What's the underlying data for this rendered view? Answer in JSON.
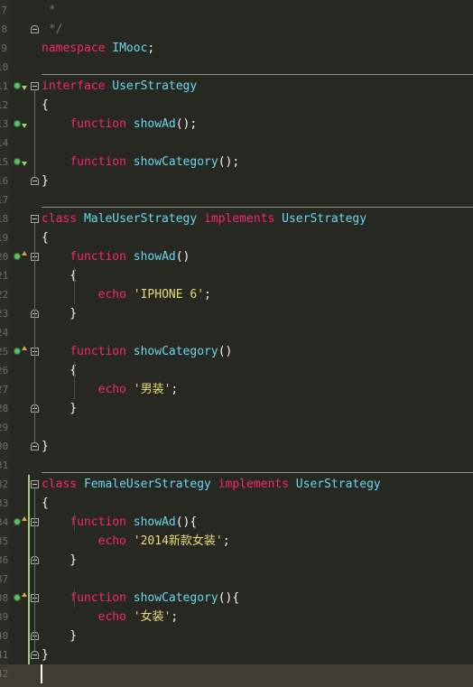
{
  "editor": {
    "lines": [
      {
        "num": "7",
        "tokens": [
          {
            "t": "cm",
            "v": " *"
          }
        ]
      },
      {
        "num": "8",
        "tokens": [
          {
            "t": "cm",
            "v": " */"
          }
        ]
      },
      {
        "num": "9",
        "tokens": [
          {
            "t": "kw",
            "v": "namespace"
          },
          {
            "t": "p",
            "v": " "
          },
          {
            "t": "cls",
            "v": "IMooc"
          },
          {
            "t": "p",
            "v": ";"
          }
        ]
      },
      {
        "num": "10",
        "tokens": []
      },
      {
        "num": "11",
        "tokens": [
          {
            "t": "kw",
            "v": "interface"
          },
          {
            "t": "p",
            "v": " "
          },
          {
            "t": "cls",
            "v": "UserStrategy"
          }
        ]
      },
      {
        "num": "12",
        "tokens": [
          {
            "t": "p",
            "v": "{"
          }
        ]
      },
      {
        "num": "13",
        "tokens": [
          {
            "t": "p",
            "v": "    "
          },
          {
            "t": "kw",
            "v": "function"
          },
          {
            "t": "p",
            "v": " "
          },
          {
            "t": "fn",
            "v": "showAd"
          },
          {
            "t": "p",
            "v": "();"
          }
        ]
      },
      {
        "num": "14",
        "tokens": []
      },
      {
        "num": "15",
        "tokens": [
          {
            "t": "p",
            "v": "    "
          },
          {
            "t": "kw",
            "v": "function"
          },
          {
            "t": "p",
            "v": " "
          },
          {
            "t": "fn",
            "v": "showCategory"
          },
          {
            "t": "p",
            "v": "();"
          }
        ]
      },
      {
        "num": "16",
        "tokens": [
          {
            "t": "p",
            "v": "}"
          }
        ]
      },
      {
        "num": "17",
        "tokens": []
      },
      {
        "num": "18",
        "tokens": [
          {
            "t": "kw",
            "v": "class"
          },
          {
            "t": "p",
            "v": " "
          },
          {
            "t": "cls",
            "v": "MaleUserStrategy"
          },
          {
            "t": "p",
            "v": " "
          },
          {
            "t": "kw",
            "v": "implements"
          },
          {
            "t": "p",
            "v": " "
          },
          {
            "t": "cls",
            "v": "UserStrategy"
          }
        ]
      },
      {
        "num": "19",
        "tokens": [
          {
            "t": "p",
            "v": "{"
          }
        ]
      },
      {
        "num": "20",
        "tokens": [
          {
            "t": "p",
            "v": "    "
          },
          {
            "t": "kw",
            "v": "function"
          },
          {
            "t": "p",
            "v": " "
          },
          {
            "t": "fn",
            "v": "showAd"
          },
          {
            "t": "p",
            "v": "()"
          }
        ]
      },
      {
        "num": "21",
        "tokens": [
          {
            "t": "p",
            "v": "    {"
          }
        ]
      },
      {
        "num": "22",
        "tokens": [
          {
            "t": "p",
            "v": "        "
          },
          {
            "t": "kw",
            "v": "echo"
          },
          {
            "t": "p",
            "v": " "
          },
          {
            "t": "str",
            "v": "'IPHONE 6'"
          },
          {
            "t": "p",
            "v": ";"
          }
        ]
      },
      {
        "num": "23",
        "tokens": [
          {
            "t": "p",
            "v": "    }"
          }
        ]
      },
      {
        "num": "24",
        "tokens": []
      },
      {
        "num": "25",
        "tokens": [
          {
            "t": "p",
            "v": "    "
          },
          {
            "t": "kw",
            "v": "function"
          },
          {
            "t": "p",
            "v": " "
          },
          {
            "t": "fn",
            "v": "showCategory"
          },
          {
            "t": "p",
            "v": "()"
          }
        ]
      },
      {
        "num": "26",
        "tokens": [
          {
            "t": "p",
            "v": "    {"
          }
        ]
      },
      {
        "num": "27",
        "tokens": [
          {
            "t": "p",
            "v": "        "
          },
          {
            "t": "kw",
            "v": "echo"
          },
          {
            "t": "p",
            "v": " "
          },
          {
            "t": "str",
            "v": "'男装'"
          },
          {
            "t": "p",
            "v": ";"
          }
        ]
      },
      {
        "num": "28",
        "tokens": [
          {
            "t": "p",
            "v": "    }"
          }
        ]
      },
      {
        "num": "29",
        "tokens": []
      },
      {
        "num": "30",
        "tokens": [
          {
            "t": "p",
            "v": "}"
          }
        ]
      },
      {
        "num": "31",
        "tokens": []
      },
      {
        "num": "32",
        "tokens": [
          {
            "t": "kw",
            "v": "class"
          },
          {
            "t": "p",
            "v": " "
          },
          {
            "t": "cls",
            "v": "FemaleUserStrategy"
          },
          {
            "t": "p",
            "v": " "
          },
          {
            "t": "kw",
            "v": "implements"
          },
          {
            "t": "p",
            "v": " "
          },
          {
            "t": "cls",
            "v": "UserStrategy"
          }
        ]
      },
      {
        "num": "33",
        "tokens": [
          {
            "t": "p",
            "v": "{"
          }
        ]
      },
      {
        "num": "34",
        "tokens": [
          {
            "t": "p",
            "v": "    "
          },
          {
            "t": "kw",
            "v": "function"
          },
          {
            "t": "p",
            "v": " "
          },
          {
            "t": "fn",
            "v": "showAd"
          },
          {
            "t": "p",
            "v": "(){"
          }
        ]
      },
      {
        "num": "35",
        "tokens": [
          {
            "t": "p",
            "v": "        "
          },
          {
            "t": "kw",
            "v": "echo"
          },
          {
            "t": "p",
            "v": " "
          },
          {
            "t": "str",
            "v": "'2014新款女装'"
          },
          {
            "t": "p",
            "v": ";"
          }
        ]
      },
      {
        "num": "36",
        "tokens": [
          {
            "t": "p",
            "v": "    }"
          }
        ]
      },
      {
        "num": "37",
        "tokens": []
      },
      {
        "num": "38",
        "tokens": [
          {
            "t": "p",
            "v": "    "
          },
          {
            "t": "kw",
            "v": "function"
          },
          {
            "t": "p",
            "v": " "
          },
          {
            "t": "fn",
            "v": "showCategory"
          },
          {
            "t": "p",
            "v": "(){"
          }
        ]
      },
      {
        "num": "39",
        "tokens": [
          {
            "t": "p",
            "v": "        "
          },
          {
            "t": "kw",
            "v": "echo"
          },
          {
            "t": "p",
            "v": " "
          },
          {
            "t": "str",
            "v": "'女装'"
          },
          {
            "t": "p",
            "v": ";"
          }
        ]
      },
      {
        "num": "40",
        "tokens": [
          {
            "t": "p",
            "v": "    }"
          }
        ]
      },
      {
        "num": "41",
        "tokens": [
          {
            "t": "p",
            "v": "}"
          }
        ]
      },
      {
        "num": "42",
        "tokens": []
      }
    ],
    "colors": {
      "background": "#272822",
      "keyword": "#f92672",
      "identifier": "#66d9ef",
      "string": "#e6db74",
      "comment": "#75715e",
      "plain": "#f8f8f2",
      "line_number": "#6f705f",
      "change_marker": "#9bd36b"
    },
    "icons": {
      "implements_marker": "implements-method-icon",
      "override_marker": "override-method-icon",
      "fold_open": "fold-open-icon",
      "fold_close": "fold-close-icon"
    }
  }
}
